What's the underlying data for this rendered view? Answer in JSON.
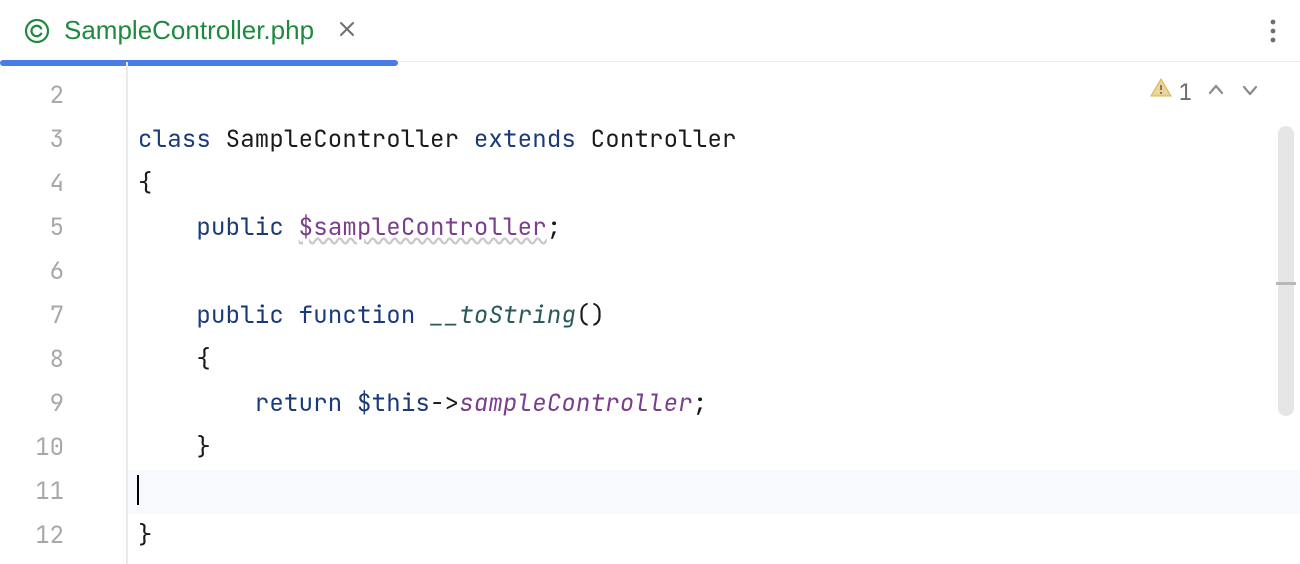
{
  "tab": {
    "title": "SampleController.php"
  },
  "inspections": {
    "warning_count": "1"
  },
  "gutter": [
    "2",
    "3",
    "4",
    "5",
    "6",
    "7",
    "8",
    "9",
    "10",
    "11",
    "12"
  ],
  "code": {
    "l3": {
      "kw1": "class",
      "name": "SampleController",
      "kw2": "extends",
      "parent": "Controller"
    },
    "l4": {
      "brace": "{"
    },
    "l5": {
      "kw": "public",
      "var": "$sampleController",
      "semi": ";"
    },
    "l6": {
      "empty": ""
    },
    "l7": {
      "kw1": "public",
      "kw2": "function",
      "fn": "__toString",
      "parens": "()"
    },
    "l8": {
      "brace": "{"
    },
    "l9": {
      "kw": "return",
      "this": "$this",
      "arrow": "->",
      "prop": "sampleController",
      "semi": ";"
    },
    "l10": {
      "brace": "}"
    },
    "l11": {
      "caret": ""
    },
    "l12": {
      "brace": "}"
    }
  }
}
